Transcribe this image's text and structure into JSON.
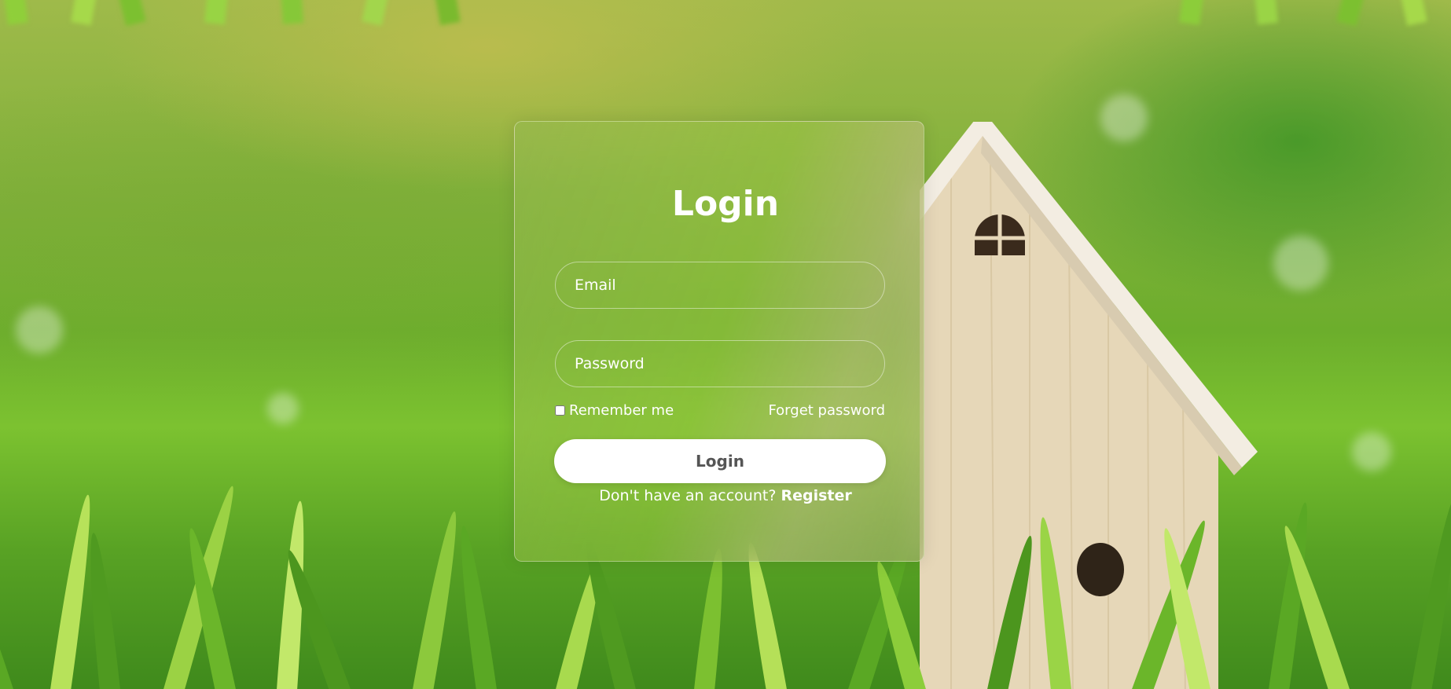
{
  "login_card": {
    "title": "Login",
    "email_placeholder": "Email",
    "password_placeholder": "Password",
    "remember_label": "Remember me",
    "remember_checked": false,
    "forget_link": "Forget password",
    "submit_label": "Login",
    "register_prompt": "Don't have an account?",
    "register_link": "Register"
  },
  "colors": {
    "button_bg": "#ffffff",
    "button_text": "#555555",
    "text": "#ffffff",
    "grass": "#6cae2c"
  }
}
